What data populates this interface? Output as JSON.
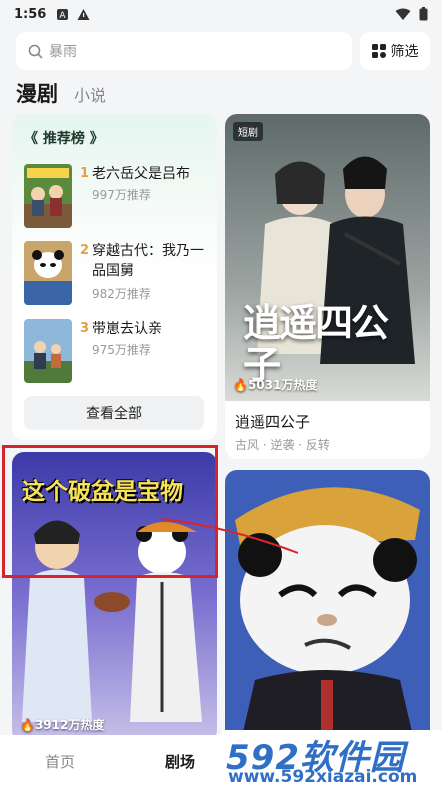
{
  "status_bar": {
    "time": "1:56"
  },
  "search": {
    "placeholder": "暴雨",
    "filter_label": "筛选"
  },
  "tabs": {
    "active": "漫剧",
    "other": "小说"
  },
  "ranking": {
    "title": "《 推荐榜 》",
    "items": [
      {
        "rank": "1",
        "name": "老六岳父是吕布",
        "recommend": "997万推荐"
      },
      {
        "rank": "2",
        "name": "穿越古代：我乃一品国舅",
        "recommend": "982万推荐"
      },
      {
        "rank": "3",
        "name": "带崽去认亲",
        "recommend": "975万推荐"
      }
    ],
    "view_all": "查看全部"
  },
  "featured": {
    "badge": "短剧",
    "poster_text": "逍遥四公子",
    "heat": "5031万热度",
    "title": "逍遥四公子",
    "tags": "古风 · 逆袭 · 反转"
  },
  "lower_left": {
    "caption": "这个破盆是宝物",
    "heat": "3912万热度"
  },
  "bottom_nav": {
    "home": "首页",
    "theater": "剧场"
  },
  "watermark": {
    "logo": "592软件园",
    "url": "www.592xiazai.com"
  },
  "colors": {
    "accent_red": "#d7262b",
    "watermark_blue": "#2f6fc6",
    "rank_orange": "#e8a03b"
  }
}
